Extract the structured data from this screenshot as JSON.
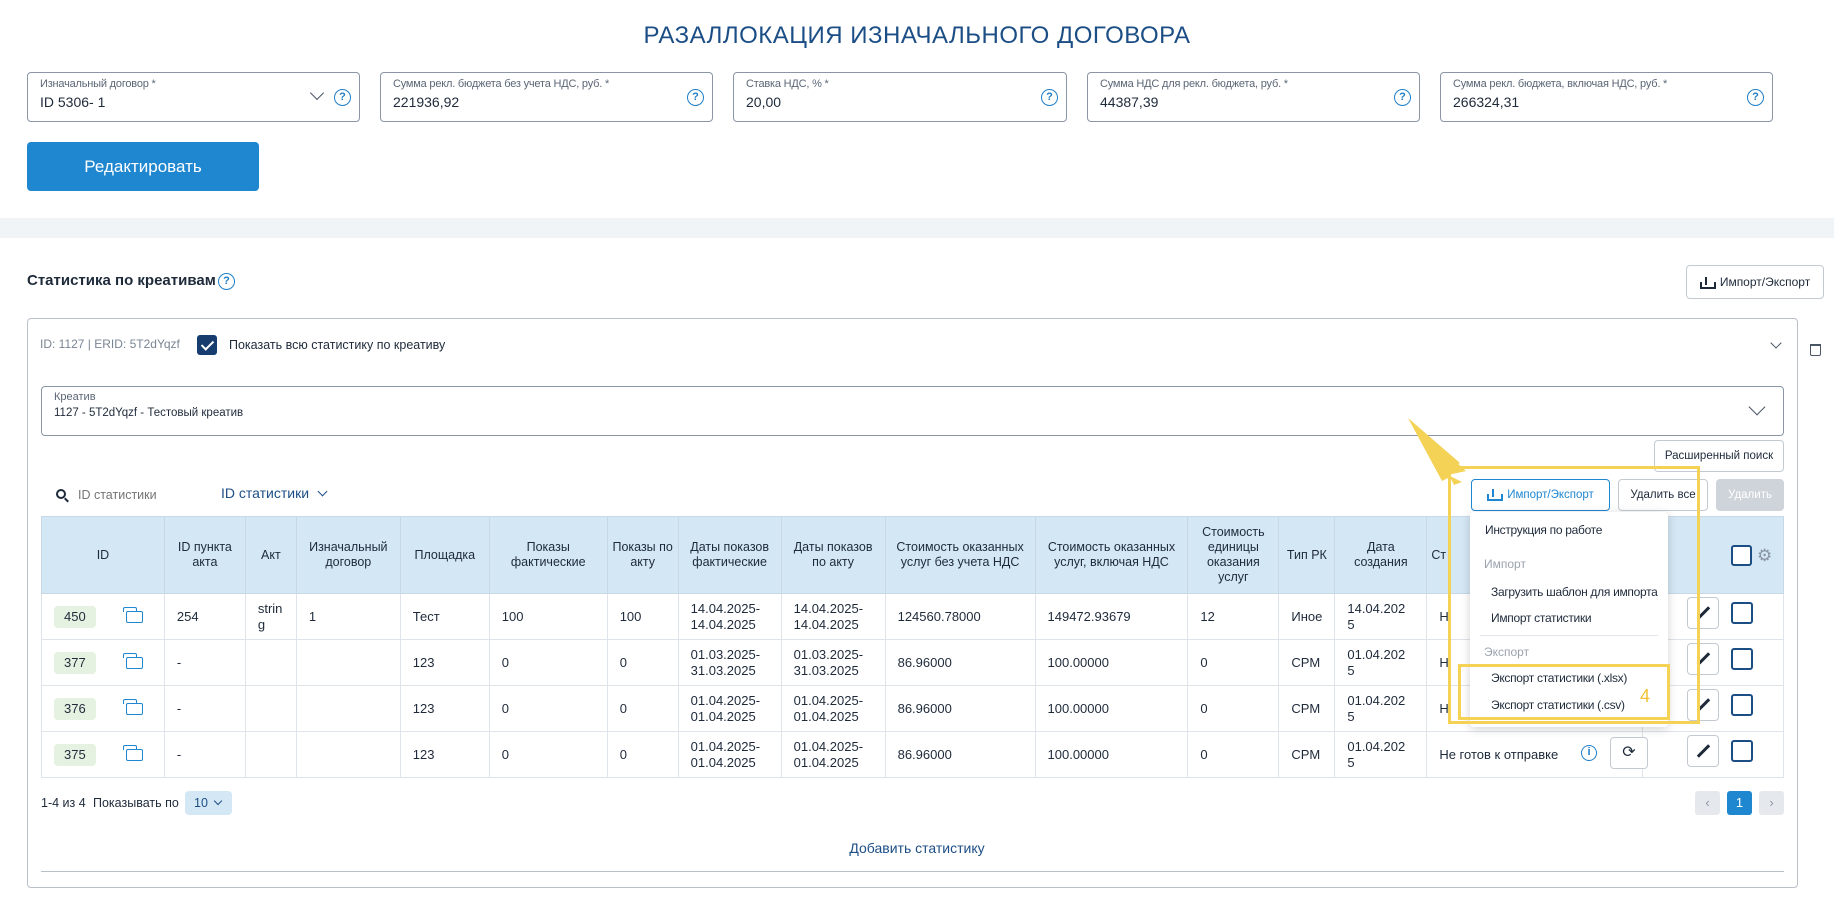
{
  "page_title": "РАЗАЛЛОКАЦИЯ ИЗНАЧАЛЬНОГО ДОГОВОРА",
  "fields": [
    {
      "label": "Изначальный договор *",
      "value": "ID 5306- 1"
    },
    {
      "label": "Сумма рекл. бюджета без учета НДС, руб. *",
      "value": "221936,92"
    },
    {
      "label": "Ставка НДС, % *",
      "value": "20,00"
    },
    {
      "label": "Сумма НДС для рекл. бюджета, руб. *",
      "value": "44387,39"
    },
    {
      "label": "Сумма рекл. бюджета, включая НДС, руб. *",
      "value": "266324,31"
    }
  ],
  "edit_button": "Редактировать",
  "stats_section": {
    "title": "Статистика по креативам",
    "import_export": "Импорт/Экспорт"
  },
  "creative_card": {
    "header": "ID: 1127 | ERID: 5T2dYqzf",
    "show_all_label": "Показать всю статистику по креативу",
    "creative_label": "Креатив",
    "creative_value": "1127 - 5T2dYqzf - Тестовый креатив",
    "advanced_search": "Расширенный поиск",
    "search_placeholder": "ID статистики",
    "search_field": "ID статистики",
    "import_export": "Импорт/Экспорт",
    "delete_all": "Удалить все",
    "delete": "Удалить"
  },
  "table": {
    "headers": [
      "ID",
      "ID пункта акта",
      "Акт",
      "Изначальный договор",
      "Площадка",
      "Показы фактические",
      "Показы по акту",
      "Даты показов фактические",
      "Даты показов по акту",
      "Стоимость оказанных услуг без учета НДС",
      "Стоимость оказанных услуг, включая НДС",
      "Стоимость единицы оказания услуг",
      "Тип РК",
      "Дата создания",
      "Ст"
    ],
    "rows": [
      {
        "id": "450",
        "act_item": "254",
        "act": "strin g",
        "contract": "1",
        "platform": "Тест",
        "shows_fact": "100",
        "shows_act": "100",
        "dates_fact": "14.04.2025- 14.04.2025",
        "dates_act": "14.04.2025- 14.04.2025",
        "cost_no_vat": "124560.78000",
        "cost_vat": "149472.93679",
        "unit_cost": "12",
        "type": "Иное",
        "created": "14.04.202 5",
        "status": "Н"
      },
      {
        "id": "377",
        "act_item": "-",
        "act": "",
        "contract": "",
        "platform": "123",
        "shows_fact": "0",
        "shows_act": "0",
        "dates_fact": "01.03.2025- 31.03.2025",
        "dates_act": "01.03.2025- 31.03.2025",
        "cost_no_vat": "86.96000",
        "cost_vat": "100.00000",
        "unit_cost": "0",
        "type": "CPM",
        "created": "01.04.202 5",
        "status": "Н"
      },
      {
        "id": "376",
        "act_item": "-",
        "act": "",
        "contract": "",
        "platform": "123",
        "shows_fact": "0",
        "shows_act": "0",
        "dates_fact": "01.04.2025- 01.04.2025",
        "dates_act": "01.04.2025- 01.04.2025",
        "cost_no_vat": "86.96000",
        "cost_vat": "100.00000",
        "unit_cost": "0",
        "type": "CPM",
        "created": "01.04.202 5",
        "status": "Н"
      },
      {
        "id": "375",
        "act_item": "-",
        "act": "",
        "contract": "",
        "platform": "123",
        "shows_fact": "0",
        "shows_act": "0",
        "dates_fact": "01.04.2025- 01.04.2025",
        "dates_act": "01.04.2025- 01.04.2025",
        "cost_no_vat": "86.96000",
        "cost_vat": "100.00000",
        "unit_cost": "0",
        "type": "CPM",
        "created": "01.04.202 5",
        "status": "Не готов к отправке"
      }
    ]
  },
  "dropdown_menu": {
    "instruction": "Инструкция по работе",
    "import_header": "Импорт",
    "load_template": "Загрузить шаблон для импорта",
    "import_stats": "Импорт статистики",
    "export_header": "Экспорт",
    "export_xlsx": "Экспорт статистики (.xlsx)",
    "export_csv": "Экспорт статистики (.csv)"
  },
  "annotation_number": "4",
  "pagination": {
    "summary": "1-4 из 4",
    "show_label": "Показывать по",
    "page_size": "10",
    "current_page": "1"
  },
  "add_statistics": "Добавить статистику",
  "colors": {
    "accent": "#1f86d0",
    "title": "#1c4e86",
    "highlight": "#f3d255",
    "header_bg": "#d4e7f5"
  }
}
